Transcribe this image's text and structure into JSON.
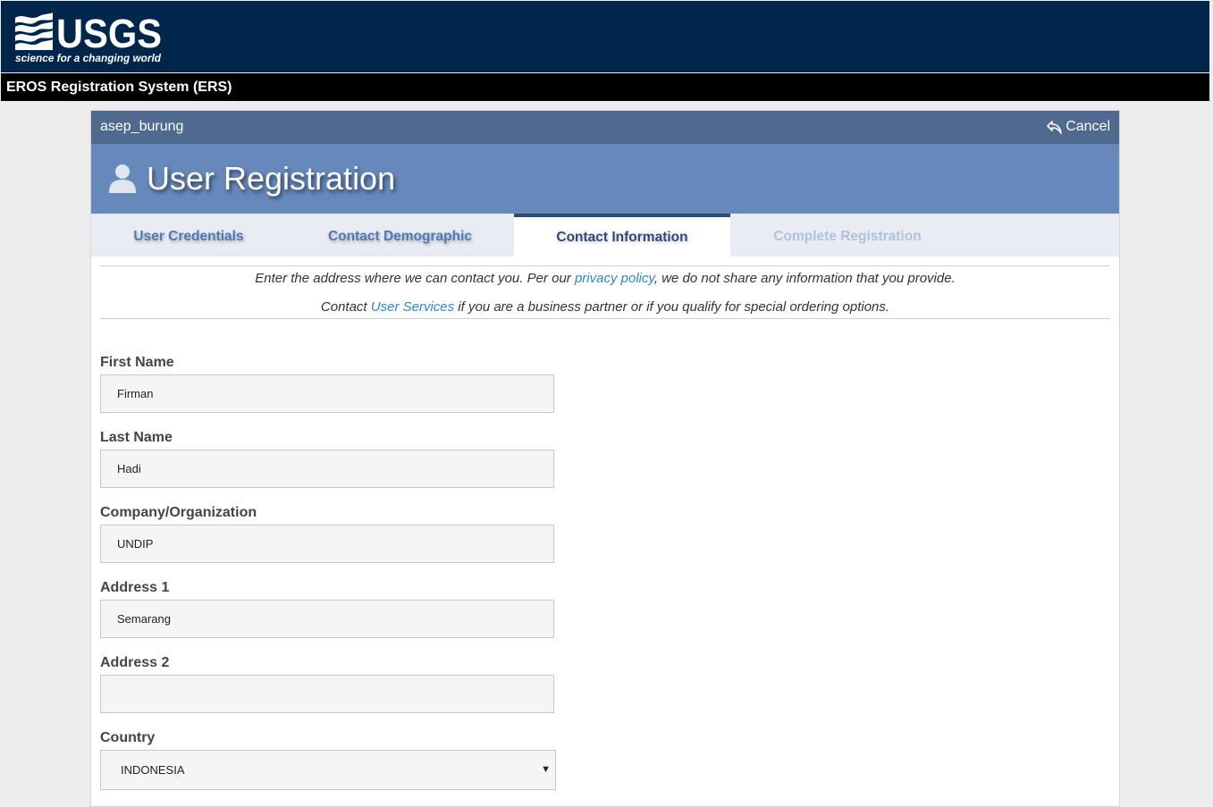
{
  "header": {
    "logo_name": "USGS",
    "logo_tagline": "science for a changing world",
    "system_title": "EROS Registration System (ERS)"
  },
  "user_bar": {
    "username": "asep_burung",
    "cancel_label": "Cancel"
  },
  "page": {
    "title": "User Registration"
  },
  "tabs": [
    {
      "label": "User Credentials",
      "state": "done"
    },
    {
      "label": "Contact Demographic",
      "state": "done"
    },
    {
      "label": "Contact Information",
      "state": "active"
    },
    {
      "label": "Complete Registration",
      "state": "disabled"
    }
  ],
  "info": {
    "line1_prefix": "Enter the address where we can contact you. Per our ",
    "privacy_link": "privacy policy",
    "line1_suffix": ", we do not share any information that you provide.",
    "line2_prefix": "Contact ",
    "services_link": "User Services",
    "line2_suffix": " if you are a business partner or if you qualify for special ordering options."
  },
  "form": {
    "first_name": {
      "label": "First Name",
      "value": "Firman"
    },
    "last_name": {
      "label": "Last Name",
      "value": "Hadi"
    },
    "company": {
      "label": "Company/Organization",
      "value": "UNDIP"
    },
    "address1": {
      "label": "Address 1",
      "value": "Semarang"
    },
    "address2": {
      "label": "Address 2",
      "value": ""
    },
    "country": {
      "label": "Country",
      "selected": "INDONESIA"
    }
  },
  "colors": {
    "header_bg": "#00264c",
    "ers_bar_bg": "#000000",
    "user_bar_bg": "#4f6a8e",
    "title_bg": "#6788bb",
    "link": "#2a88c8"
  },
  "icons": {
    "cancel": "reply-arrow-icon",
    "title": "user-silhouette-icon",
    "select": "caret-down-icon"
  }
}
